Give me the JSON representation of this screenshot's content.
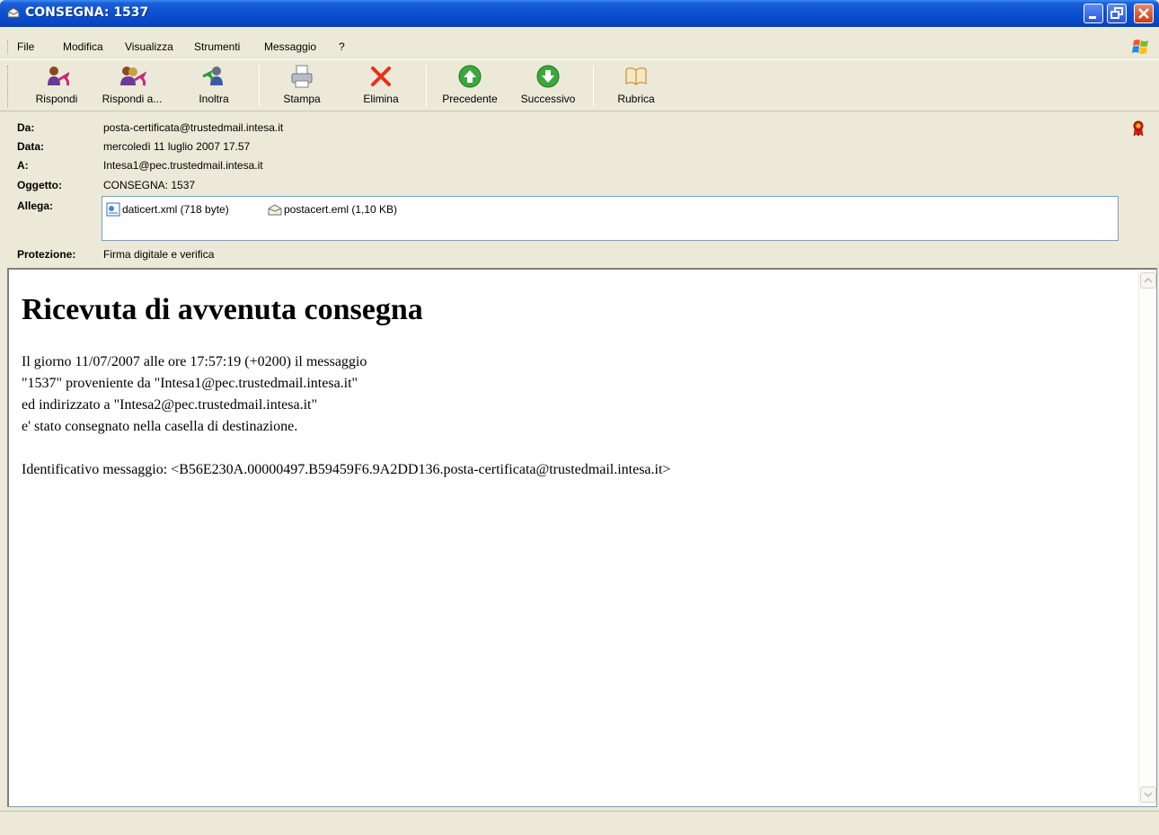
{
  "window": {
    "title": "CONSEGNA: 1537"
  },
  "menu": {
    "items": [
      "File",
      "Modifica",
      "Visualizza",
      "Strumenti",
      "Messaggio",
      "?"
    ]
  },
  "toolbar": {
    "reply": "Rispondi",
    "reply_all": "Rispondi a...",
    "forward": "Inoltra",
    "print": "Stampa",
    "delete": "Elimina",
    "previous": "Precedente",
    "next": "Successivo",
    "addressbook": "Rubrica"
  },
  "header": {
    "from_label": "Da:",
    "from_value": "posta-certificata@trustedmail.intesa.it",
    "date_label": "Data:",
    "date_value": "mercoledì 11 luglio 2007 17.57",
    "to_label": "A:",
    "to_value": "Intesa1@pec.trustedmail.intesa.it",
    "subject_label": "Oggetto:",
    "subject_value": "CONSEGNA: 1537",
    "attach_label": "Allega:",
    "attachments": [
      {
        "name": "daticert.xml (718 byte)",
        "icon": "xml-file-icon"
      },
      {
        "name": "postacert.eml (1,10 KB)",
        "icon": "email-file-icon"
      }
    ],
    "security_label": "Protezione:",
    "security_value": "Firma digitale e verifica"
  },
  "message": {
    "title": "Ricevuta di avvenuta consegna",
    "lines": [
      "Il giorno 11/07/2007 alle ore 17:57:19 (+0200) il messaggio",
      "\"1537\" proveniente da \"Intesa1@pec.trustedmail.intesa.it\"",
      "ed indirizzato a \"Intesa2@pec.trustedmail.intesa.it\"",
      "e' stato consegnato nella casella di destinazione."
    ],
    "id_line": "Identificativo messaggio: <B56E230A.00000497.B59459F6.9A2DD136.posta-certificata@trustedmail.intesa.it>"
  }
}
